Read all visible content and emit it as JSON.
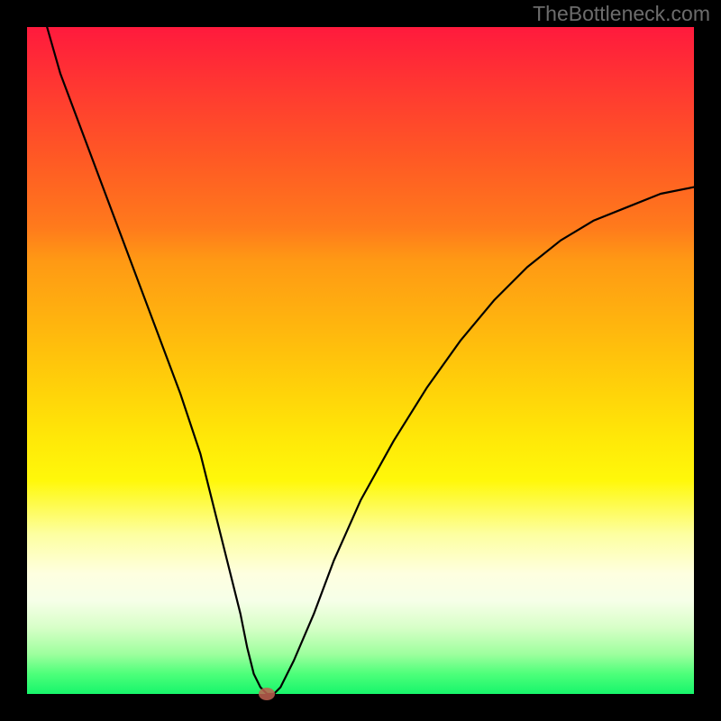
{
  "watermark": "TheBottleneck.com",
  "chart_data": {
    "type": "line",
    "title": "",
    "xlabel": "",
    "ylabel": "",
    "xlim": [
      0,
      100
    ],
    "ylim": [
      0,
      100
    ],
    "grid": false,
    "legend": false,
    "background_gradient": {
      "top": "#ff1a3d",
      "middle": "#ffe908",
      "bottom": "#17f56b"
    },
    "series": [
      {
        "name": "bottleneck-curve",
        "color": "#000000",
        "x": [
          3,
          5,
          8,
          11,
          14,
          17,
          20,
          23,
          26,
          28,
          30,
          32,
          33,
          34,
          35,
          36,
          37,
          38,
          40,
          43,
          46,
          50,
          55,
          60,
          65,
          70,
          75,
          80,
          85,
          90,
          95,
          100
        ],
        "values": [
          100,
          93,
          85,
          77,
          69,
          61,
          53,
          45,
          36,
          28,
          20,
          12,
          7,
          3,
          1,
          0,
          0,
          1,
          5,
          12,
          20,
          29,
          38,
          46,
          53,
          59,
          64,
          68,
          71,
          73,
          75,
          76
        ]
      }
    ],
    "marker": {
      "x": 36,
      "y": 0,
      "color": "#c06050"
    }
  }
}
